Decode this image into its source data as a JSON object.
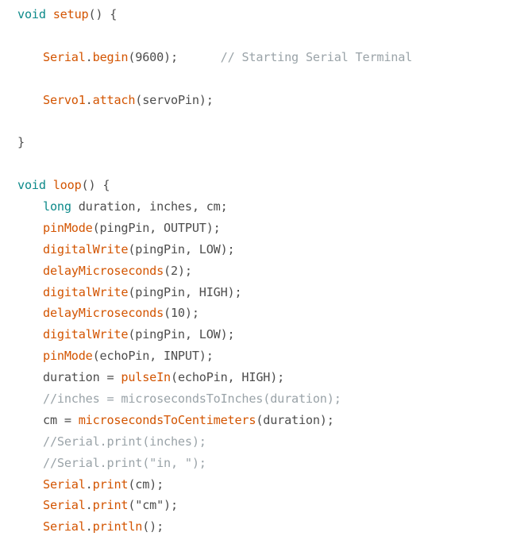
{
  "editor": {
    "colors": {
      "plain": "#4d4d4d",
      "keyword": "#0d8a8a",
      "function": "#d35400",
      "comment": "#9aa3a8",
      "background": "#ffffff"
    },
    "lines": [
      {
        "indent": 0,
        "tokens": [
          {
            "t": "kw",
            "v": "void"
          },
          {
            "t": "plain",
            "v": " "
          },
          {
            "t": "fn",
            "v": "setup"
          },
          {
            "t": "plain",
            "v": "() {"
          }
        ]
      },
      {
        "indent": 0,
        "tokens": []
      },
      {
        "indent": 1,
        "tokens": [
          {
            "t": "fn",
            "v": "Serial"
          },
          {
            "t": "plain",
            "v": "."
          },
          {
            "t": "fn",
            "v": "begin"
          },
          {
            "t": "plain",
            "v": "(9600);      "
          },
          {
            "t": "comment",
            "v": "// Starting Serial Terminal"
          }
        ]
      },
      {
        "indent": 0,
        "tokens": []
      },
      {
        "indent": 1,
        "tokens": [
          {
            "t": "fn",
            "v": "Servo1"
          },
          {
            "t": "plain",
            "v": "."
          },
          {
            "t": "fn",
            "v": "attach"
          },
          {
            "t": "plain",
            "v": "(servoPin);"
          }
        ]
      },
      {
        "indent": 0,
        "tokens": []
      },
      {
        "indent": 0,
        "tokens": [
          {
            "t": "plain",
            "v": "}"
          }
        ]
      },
      {
        "indent": 0,
        "tokens": []
      },
      {
        "indent": 0,
        "tokens": [
          {
            "t": "kw",
            "v": "void"
          },
          {
            "t": "plain",
            "v": " "
          },
          {
            "t": "fn",
            "v": "loop"
          },
          {
            "t": "plain",
            "v": "() {"
          }
        ]
      },
      {
        "indent": 1,
        "tokens": [
          {
            "t": "kw",
            "v": "long"
          },
          {
            "t": "plain",
            "v": " duration, inches, cm;"
          }
        ]
      },
      {
        "indent": 1,
        "tokens": [
          {
            "t": "fn",
            "v": "pinMode"
          },
          {
            "t": "plain",
            "v": "(pingPin, OUTPUT);"
          }
        ]
      },
      {
        "indent": 1,
        "tokens": [
          {
            "t": "fn",
            "v": "digitalWrite"
          },
          {
            "t": "plain",
            "v": "(pingPin, LOW);"
          }
        ]
      },
      {
        "indent": 1,
        "tokens": [
          {
            "t": "fn",
            "v": "delayMicroseconds"
          },
          {
            "t": "plain",
            "v": "(2);"
          }
        ]
      },
      {
        "indent": 1,
        "tokens": [
          {
            "t": "fn",
            "v": "digitalWrite"
          },
          {
            "t": "plain",
            "v": "(pingPin, HIGH);"
          }
        ]
      },
      {
        "indent": 1,
        "tokens": [
          {
            "t": "fn",
            "v": "delayMicroseconds"
          },
          {
            "t": "plain",
            "v": "(10);"
          }
        ]
      },
      {
        "indent": 1,
        "tokens": [
          {
            "t": "fn",
            "v": "digitalWrite"
          },
          {
            "t": "plain",
            "v": "(pingPin, LOW);"
          }
        ]
      },
      {
        "indent": 1,
        "tokens": [
          {
            "t": "fn",
            "v": "pinMode"
          },
          {
            "t": "plain",
            "v": "(echoPin, INPUT);"
          }
        ]
      },
      {
        "indent": 1,
        "tokens": [
          {
            "t": "plain",
            "v": "duration = "
          },
          {
            "t": "fn",
            "v": "pulseIn"
          },
          {
            "t": "plain",
            "v": "(echoPin, HIGH);"
          }
        ]
      },
      {
        "indent": 1,
        "tokens": [
          {
            "t": "comment",
            "v": "//inches = microsecondsToInches(duration);"
          }
        ]
      },
      {
        "indent": 1,
        "tokens": [
          {
            "t": "plain",
            "v": "cm = "
          },
          {
            "t": "fn",
            "v": "microsecondsToCentimeters"
          },
          {
            "t": "plain",
            "v": "(duration);"
          }
        ]
      },
      {
        "indent": 1,
        "tokens": [
          {
            "t": "comment",
            "v": "//Serial.print(inches);"
          }
        ]
      },
      {
        "indent": 1,
        "tokens": [
          {
            "t": "comment",
            "v": "//Serial.print(\"in, \");"
          }
        ]
      },
      {
        "indent": 1,
        "tokens": [
          {
            "t": "fn",
            "v": "Serial"
          },
          {
            "t": "plain",
            "v": "."
          },
          {
            "t": "fn",
            "v": "print"
          },
          {
            "t": "plain",
            "v": "(cm);"
          }
        ]
      },
      {
        "indent": 1,
        "tokens": [
          {
            "t": "fn",
            "v": "Serial"
          },
          {
            "t": "plain",
            "v": "."
          },
          {
            "t": "fn",
            "v": "print"
          },
          {
            "t": "plain",
            "v": "(\"cm\");"
          }
        ]
      },
      {
        "indent": 1,
        "tokens": [
          {
            "t": "fn",
            "v": "Serial"
          },
          {
            "t": "plain",
            "v": "."
          },
          {
            "t": "fn",
            "v": "println"
          },
          {
            "t": "plain",
            "v": "();"
          }
        ]
      }
    ]
  }
}
